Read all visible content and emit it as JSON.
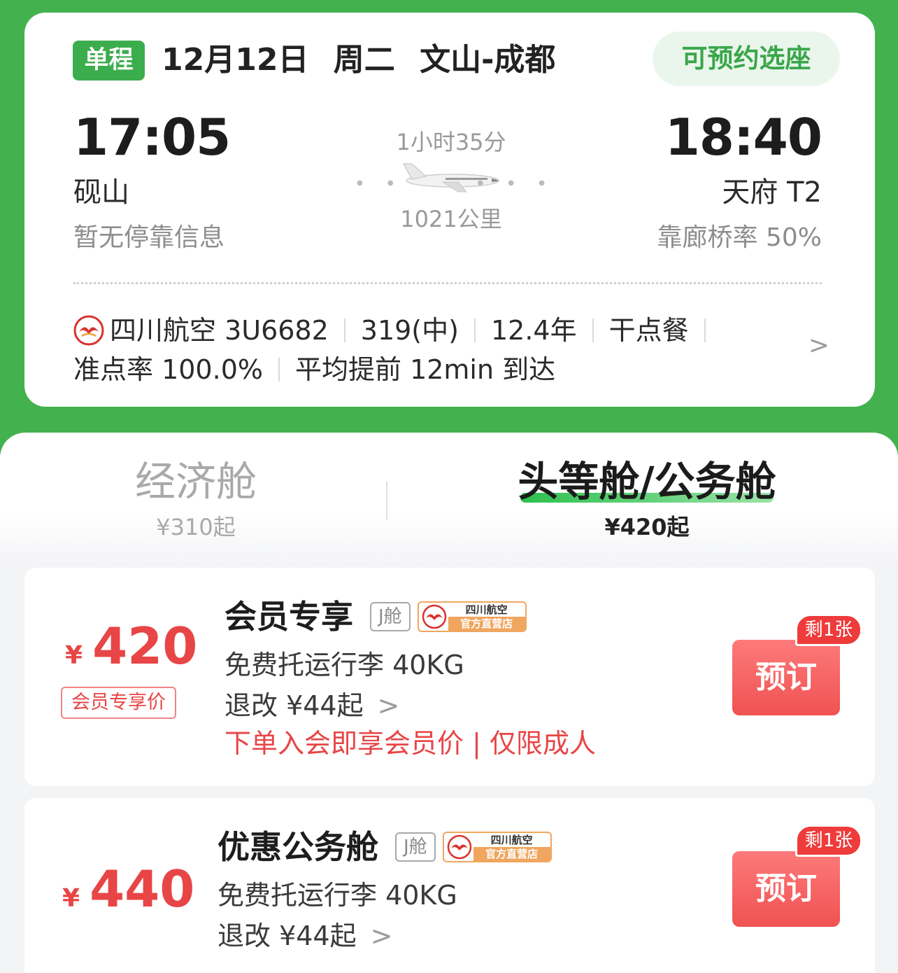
{
  "trip": {
    "type_badge": "单程",
    "date": "12月12日",
    "weekday": "周二",
    "route": "文山-成都",
    "seat_pill": "可预约选座"
  },
  "departure": {
    "time": "17:05",
    "airport": "砚山",
    "sub": "暂无停靠信息"
  },
  "arrival": {
    "time": "18:40",
    "airport": "天府 T2",
    "sub": "靠廊桥率 50%"
  },
  "flight": {
    "duration": "1小时35分",
    "distance": "1021公里",
    "airline": "四川航空 3U6682",
    "aircraft": "319(中)",
    "age": "12.4年",
    "meal": "干点餐",
    "ontime": "准点率 100.0%",
    "early": "平均提前 12min 到达",
    "chevron": ">"
  },
  "cabins": {
    "economy": {
      "name": "经济舱",
      "price": "¥310起"
    },
    "first": {
      "name": "头等舱/公务舱",
      "price": "¥420起"
    }
  },
  "fares": [
    {
      "yen": "¥",
      "amount": "420",
      "member_tag": "会员专享价",
      "title": "会员专享",
      "cabin_tag": "J舱",
      "official_t1": "四川航空",
      "official_t2": "官方直营店",
      "baggage": "免费托运行李 40KG",
      "refund": "退改 ¥44起",
      "chevron": ">",
      "note": "下单入会即享会员价 | 仅限成人",
      "book": "预订",
      "remain": "剩1张"
    },
    {
      "yen": "¥",
      "amount": "440",
      "title": "优惠公务舱",
      "cabin_tag": "J舱",
      "official_t1": "四川航空",
      "official_t2": "官方直营店",
      "baggage": "免费托运行李 40KG",
      "refund": "退改 ¥44起",
      "chevron": ">",
      "book": "预订",
      "remain": "剩1张"
    }
  ],
  "colors": {
    "brand_green": "#44b14f",
    "accent_red": "#e84546"
  }
}
